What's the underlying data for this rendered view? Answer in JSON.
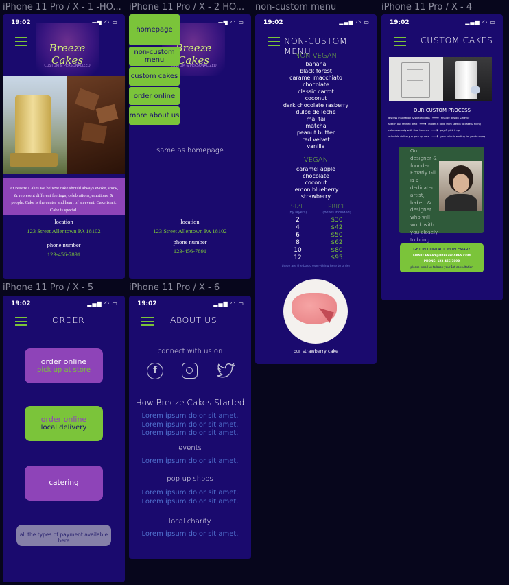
{
  "frames": {
    "f1": "iPhone 11 Pro / X - 1 -HO...",
    "f2": "iPhone 11 Pro / X - 2 HO...",
    "f3": "non-custom menu",
    "f4": "iPhone 11 Pro / X - 4",
    "f5": "iPhone 11 Pro / X - 5",
    "f6": "iPhone 11 Pro / X - 6"
  },
  "status": {
    "time": "19:02",
    "icons": "▂▄▆ ◠ ▭"
  },
  "home": {
    "logo_text": "Breeze Cakes",
    "logo_sub": "CUSTOM & PERSONALIZED",
    "about": "At Breeze Cakes we believe cake should always evoke, show, & represent different feelings, celebrations, emotions, & people. Cake is the center and heart of an event. Cake is art. Cake is special.",
    "location_label": "location",
    "address": "123 Street Allentown PA 18102",
    "phone_label": "phone number",
    "phone": "123-456-7891"
  },
  "menu_overlay": {
    "items": [
      "homepage",
      "non-custom menu",
      "custom cakes",
      "order online",
      "more about us"
    ],
    "note": "same as homepage",
    "location_label": "location",
    "address": "123 Street Allentown PA 18102",
    "phone_label": "phone number",
    "phone": "123-456-7891"
  },
  "noncustom": {
    "title": "NON-CUSTOM MENU",
    "nonvegan_title": "NON-VEGAN",
    "nonvegan": [
      "banana",
      "black forest",
      "caramel macchiato",
      "chocolate",
      "classic carrot",
      "coconut",
      "dark chocolate rasberry",
      "dulce de leche",
      "mai tai",
      "matcha",
      "peanut butter",
      "red velvet",
      "vanilla"
    ],
    "vegan_title": "VEGAN",
    "vegan": [
      "caramel apple",
      "chocolate",
      "coconut",
      "lemon blueberry",
      "strawberry"
    ],
    "size_label": "SIZE",
    "size_sub": "(by layers)",
    "price_label": "PRICE",
    "price_sub": "(boxes included)",
    "sizes": [
      "2",
      "4",
      "6",
      "8",
      "10",
      "12"
    ],
    "prices": [
      "$30",
      "$42",
      "$50",
      "$62",
      "$80",
      "$95"
    ],
    "note": "these are the basic everything here to order",
    "caption": "our strawberry cake"
  },
  "custom": {
    "title": "CUSTOM CAKES",
    "process_title": "OUR CUSTOM PROCESS",
    "steps": [
      {
        "a": "discuss inspiration & sketch ideas",
        "b": "finalize design & flavor"
      },
      {
        "a": "sketch our refined draft",
        "b": "model & bake from sketch to cake & filling"
      },
      {
        "a": "cake assembly with final touches",
        "b": "pay & pick it up"
      },
      {
        "a": "schedule delivery or pick up date",
        "b": "your cake is waiting for you to enjoy"
      }
    ],
    "bio": "Our designer & founder Emarly Gil is a dedicated artist, baker, & designer who will work with you closely to bring your dream cake into life.",
    "contact_btn": "GET IN CONTACT WITH EMARY",
    "email": "EMAIL: EMARY@BREEZECAKES.COM",
    "phone": "PHONE: 123-456-7890",
    "contact_note": "please email us to book your 1st consultation"
  },
  "order": {
    "title": "ORDER",
    "btn1_line1": "order online",
    "btn1_line2": "pick up at store",
    "btn2_line1": "order online",
    "btn2_line2": "local delivery",
    "btn3": "catering",
    "btn4": "all the types of payment available here"
  },
  "about": {
    "title": "ABOUT US",
    "connect": "connect with us on",
    "story_title": "How Breeze Cakes Started",
    "lorem3": [
      "Lorem ipsum dolor sit amet.",
      "Lorem ipsum dolor sit amet.",
      "Lorem ipsum dolor sit amet."
    ],
    "events": "events",
    "events_lorem": "Lorem ipsum dolor sit amet.",
    "popup": "pop-up shops",
    "popup_lorem": [
      "Lorem ipsum dolor sit amet.",
      "Lorem ipsum dolor sit amet."
    ],
    "charity": "local charity",
    "charity_lorem": "Lorem ipsum dolor sit amet."
  },
  "colors": {
    "bg": "#07061c",
    "phone": "#1a0a6e",
    "green": "#7bc43a",
    "purple": "#8e44b8",
    "lorem": "#4f6fcc"
  }
}
